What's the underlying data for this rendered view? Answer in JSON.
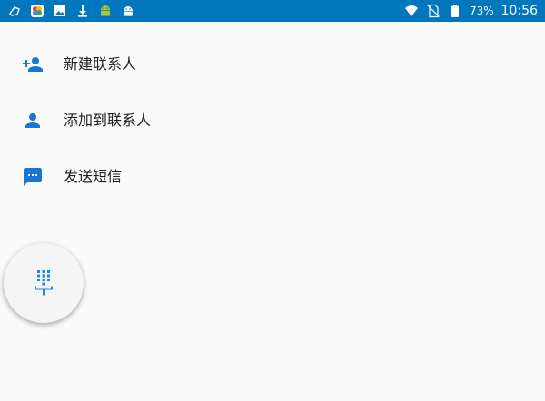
{
  "status_bar": {
    "battery_text": "73%",
    "time": "10:56",
    "icons_left": [
      "notification-icon",
      "photos-icon",
      "gallery-icon",
      "download-icon",
      "android-icon",
      "android-alt-icon"
    ],
    "icons_right": [
      "wifi-icon",
      "no-sim-icon",
      "battery-icon"
    ],
    "background": "#0277bd"
  },
  "menu": {
    "items": [
      {
        "label": "新建联系人",
        "icon": "add-person-icon"
      },
      {
        "label": "添加到联系人",
        "icon": "person-icon"
      },
      {
        "label": "发送短信",
        "icon": "message-icon"
      }
    ],
    "icon_color": "#1976d2"
  },
  "fab": {
    "icon": "dialpad-icon",
    "icon_color": "#1e88e5"
  }
}
